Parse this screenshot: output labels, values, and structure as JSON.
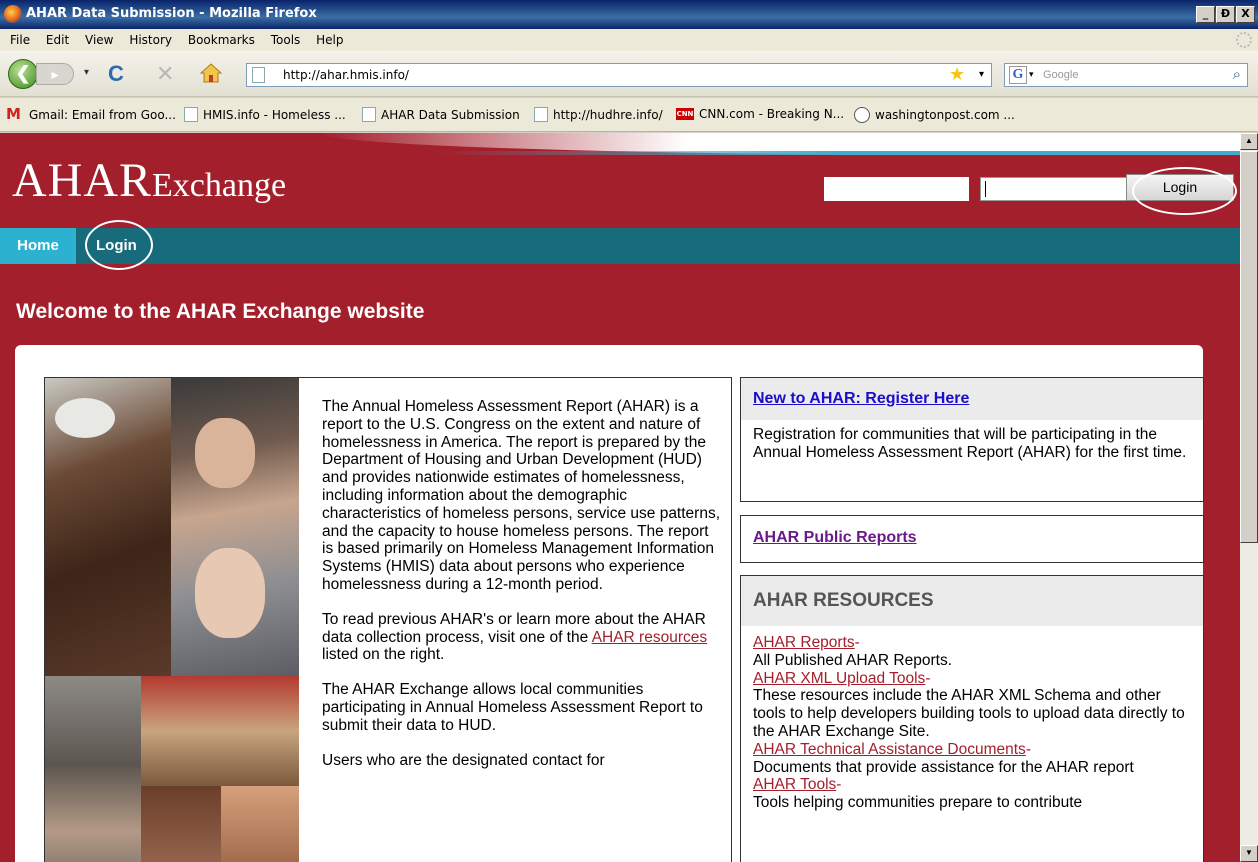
{
  "window": {
    "title": "AHAR Data Submission - Mozilla Firefox",
    "min_label": "_",
    "max_label": "Ɖ",
    "close_label": "X"
  },
  "menu": [
    "File",
    "Edit",
    "View",
    "History",
    "Bookmarks",
    "Tools",
    "Help"
  ],
  "toolbar": {
    "back_glyph": "❮",
    "forward_glyph": "▸",
    "dropdown_glyph": "▾",
    "reload_glyph": "C",
    "stop_glyph": "✕",
    "url": "http://ahar.hmis.info/",
    "star_glyph": "★",
    "search_engine_letter": "G",
    "search_placeholder": "Google",
    "search_glyph": "⌕"
  },
  "bookmarks": [
    {
      "label": "Gmail: Email from Goo...",
      "icon": "gmail-icon"
    },
    {
      "label": "HMIS.info - Homeless ...",
      "icon": "page-icon"
    },
    {
      "label": "AHAR Data Submission",
      "icon": "page-icon"
    },
    {
      "label": "http://hudhre.info/",
      "icon": "page-icon"
    },
    {
      "label": "CNN.com - Breaking N...",
      "icon": "cnn-icon"
    },
    {
      "label": "washingtonpost.com ...",
      "icon": "wp-icon"
    }
  ],
  "site": {
    "logo_main": "AHAR",
    "logo_sub": "Exchange",
    "login_button": "Login",
    "nav": {
      "home": "Home",
      "login": "Login"
    },
    "welcome": "Welcome to the AHAR Exchange website",
    "intro": {
      "p1": "The Annual Homeless Assessment Report (AHAR) is a report to the U.S. Congress on the extent and nature of homelessness in America. The report is prepared by the Department of Housing and Urban Development (HUD) and provides nationwide estimates of homelessness, including information about the demographic characteristics of homeless persons, service use patterns, and the capacity to house homeless persons. The report is based primarily on Homeless Management Information Systems (HMIS) data about persons who experience homelessness during a 12-month period.",
      "p2_before": "To read previous AHAR's or learn more about the AHAR data collection process, visit one of the ",
      "p2_link": "AHAR resources",
      "p2_after": " listed on the right.",
      "p3": "The AHAR Exchange allows local communities participating in Annual Homeless Assessment Report to submit their data to HUD.",
      "p4": "Users who are the designated contact for"
    },
    "register": {
      "link": "New to AHAR: Register Here",
      "desc": "Registration for communities that will be participating in the Annual Homeless Assessment Report (AHAR) for the first time."
    },
    "public_reports": "AHAR Public Reports",
    "resources": {
      "title": "AHAR RESOURCES",
      "items": [
        {
          "link": "AHAR Reports",
          "desc": "All Published AHAR Reports."
        },
        {
          "link": "AHAR XML Upload Tools",
          "desc": "These resources include the AHAR XML Schema and other tools to help developers building tools to upload data directly to the AHAR Exchange Site."
        },
        {
          "link": "AHAR Technical Assistance Documents",
          "desc": "Documents that provide assistance for the AHAR report"
        },
        {
          "link": "AHAR Tools",
          "desc": "Tools helping communities prepare to contribute"
        }
      ]
    }
  }
}
